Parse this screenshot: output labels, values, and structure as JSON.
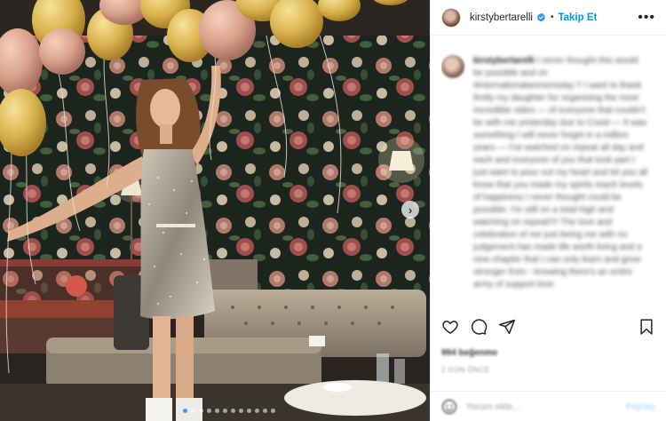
{
  "header": {
    "username": "kirstybertarelli",
    "follow_label": "Takip Et",
    "separator": "•",
    "more_label": "•••"
  },
  "post": {
    "caption_username": "kirstybertarelli",
    "caption_text": "I never thought this would be possible and on #internationalwomensday !! I want to thank firstly my daughter for organising the most incredible video — of everyone that couldn't be with me yesterday due to Covid — It was something I will never forget in a million years — I've watched on repeat all day and each and everyone of you that took part I just want to pour out my heart and let you all know that you made my spirits reach levels of happiness I never thought could be possible. I'm still on a total high and watching on repeat!!!! The love and celebration of me just being me with no judgement has made life worth living and a new chapter that I can only learn and grow stronger from - knowing there's an entire army of support love",
    "hashtag": "#internationalwomensday",
    "likes": "994 beğenme",
    "time_ago": "2 GÜN ÖNCE"
  },
  "comment_box": {
    "placeholder": "Yorum ekle...",
    "post_label": "Paylaş"
  },
  "carousel": {
    "next_label": "›",
    "dot_count": 12,
    "active_dot": 0
  },
  "colors": {
    "accent": "#0095f6",
    "verified": "#3897f0",
    "text": "#262626",
    "border": "#efefef"
  },
  "icons": [
    "verified-badge-icon",
    "heart-icon",
    "comment-icon",
    "share-icon",
    "bookmark-icon",
    "emoji-icon",
    "more-options-icon",
    "carousel-next-icon"
  ]
}
